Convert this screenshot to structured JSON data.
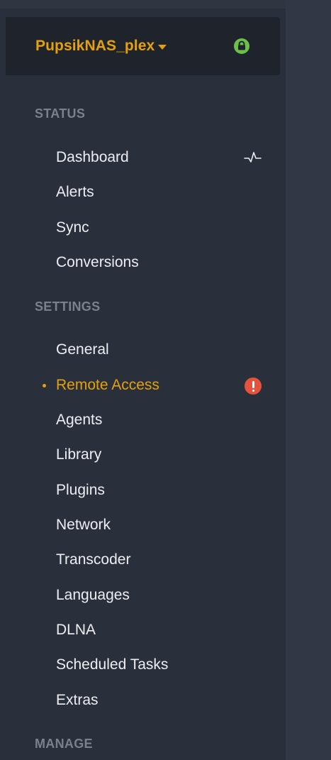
{
  "server": {
    "name": "PupsikNAS_plex",
    "dropdown_icon": "caret-down-icon",
    "status_icon": "lock-icon",
    "status_color": "#6cc04a"
  },
  "colors": {
    "accent": "#e5a00d",
    "alert": "#e5533d",
    "sidebar_bg": "#2a303b",
    "header_bg": "#1f242c"
  },
  "sections": {
    "status": {
      "title": "STATUS",
      "items": [
        {
          "label": "Dashboard",
          "icon": "activity-icon"
        },
        {
          "label": "Alerts"
        },
        {
          "label": "Sync"
        },
        {
          "label": "Conversions"
        }
      ]
    },
    "settings": {
      "title": "SETTINGS",
      "items": [
        {
          "label": "General"
        },
        {
          "label": "Remote Access",
          "active": true,
          "icon": "alert-icon"
        },
        {
          "label": "Agents"
        },
        {
          "label": "Library"
        },
        {
          "label": "Plugins"
        },
        {
          "label": "Network"
        },
        {
          "label": "Transcoder"
        },
        {
          "label": "Languages"
        },
        {
          "label": "DLNA"
        },
        {
          "label": "Scheduled Tasks"
        },
        {
          "label": "Extras"
        }
      ]
    },
    "manage": {
      "title": "MANAGE"
    }
  }
}
